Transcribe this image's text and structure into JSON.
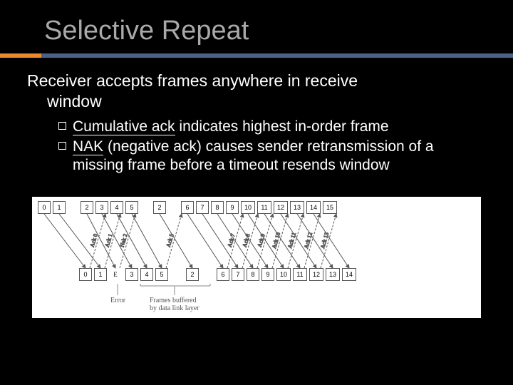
{
  "title": "Selective Repeat",
  "main_text_line1": "Receiver accepts frames anywhere in receive",
  "main_text_line2": "window",
  "bullets": [
    {
      "underlined": "Cumulative ack",
      "rest": " indicates highest in-order frame"
    },
    {
      "underlined": "",
      "prefix": "NAK",
      "rest": " (negative ack) causes sender retransmission of a missing frame before a timeout resends window"
    }
  ],
  "diagram": {
    "sender_frames": [
      "0",
      "1",
      "2",
      "3",
      "4",
      "5",
      "2",
      "6",
      "7",
      "8",
      "9",
      "10",
      "11",
      "12",
      "13",
      "14",
      "15"
    ],
    "receiver_frames": [
      "0",
      "1",
      "E",
      "3",
      "4",
      "5",
      "2",
      "6",
      "7",
      "8",
      "9",
      "10",
      "11",
      "12",
      "13",
      "14"
    ],
    "acks": [
      "Ack 0",
      "Ack 1",
      "Nak 2",
      "",
      "",
      "Ack 5",
      "",
      "Ack 7",
      "Ack 8",
      "Ack 9",
      "Ack 10",
      "Ack 11",
      "Ack 12",
      "Ack 13"
    ],
    "error_label": "Error",
    "buffered_label_line1": "Frames buffered",
    "buffered_label_line2": "by data link layer"
  }
}
